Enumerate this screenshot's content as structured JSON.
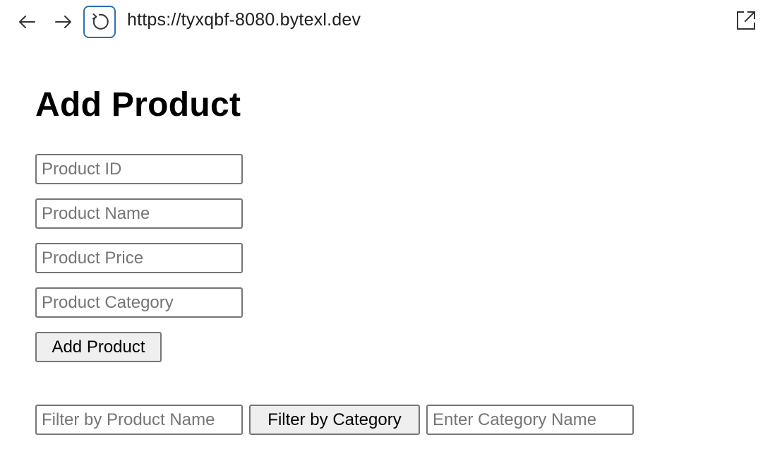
{
  "browser": {
    "url": "https://tyxqbf-8080.bytexl.dev",
    "icons": {
      "back": "arrow-left-icon",
      "forward": "arrow-right-icon",
      "reload": "reload-icon",
      "open_external": "open-external-icon"
    },
    "reload_focus_color": "#2f6fb3"
  },
  "page": {
    "title": "Add Product",
    "form": {
      "product_id_placeholder": "Product ID",
      "product_name_placeholder": "Product Name",
      "product_price_placeholder": "Product Price",
      "product_category_placeholder": "Product Category",
      "add_button_label": "Add Product"
    },
    "filters": {
      "name_filter_placeholder": "Filter by Product Name",
      "category_button_label": "Filter by Category",
      "category_input_placeholder": "Enter Category Name"
    }
  }
}
